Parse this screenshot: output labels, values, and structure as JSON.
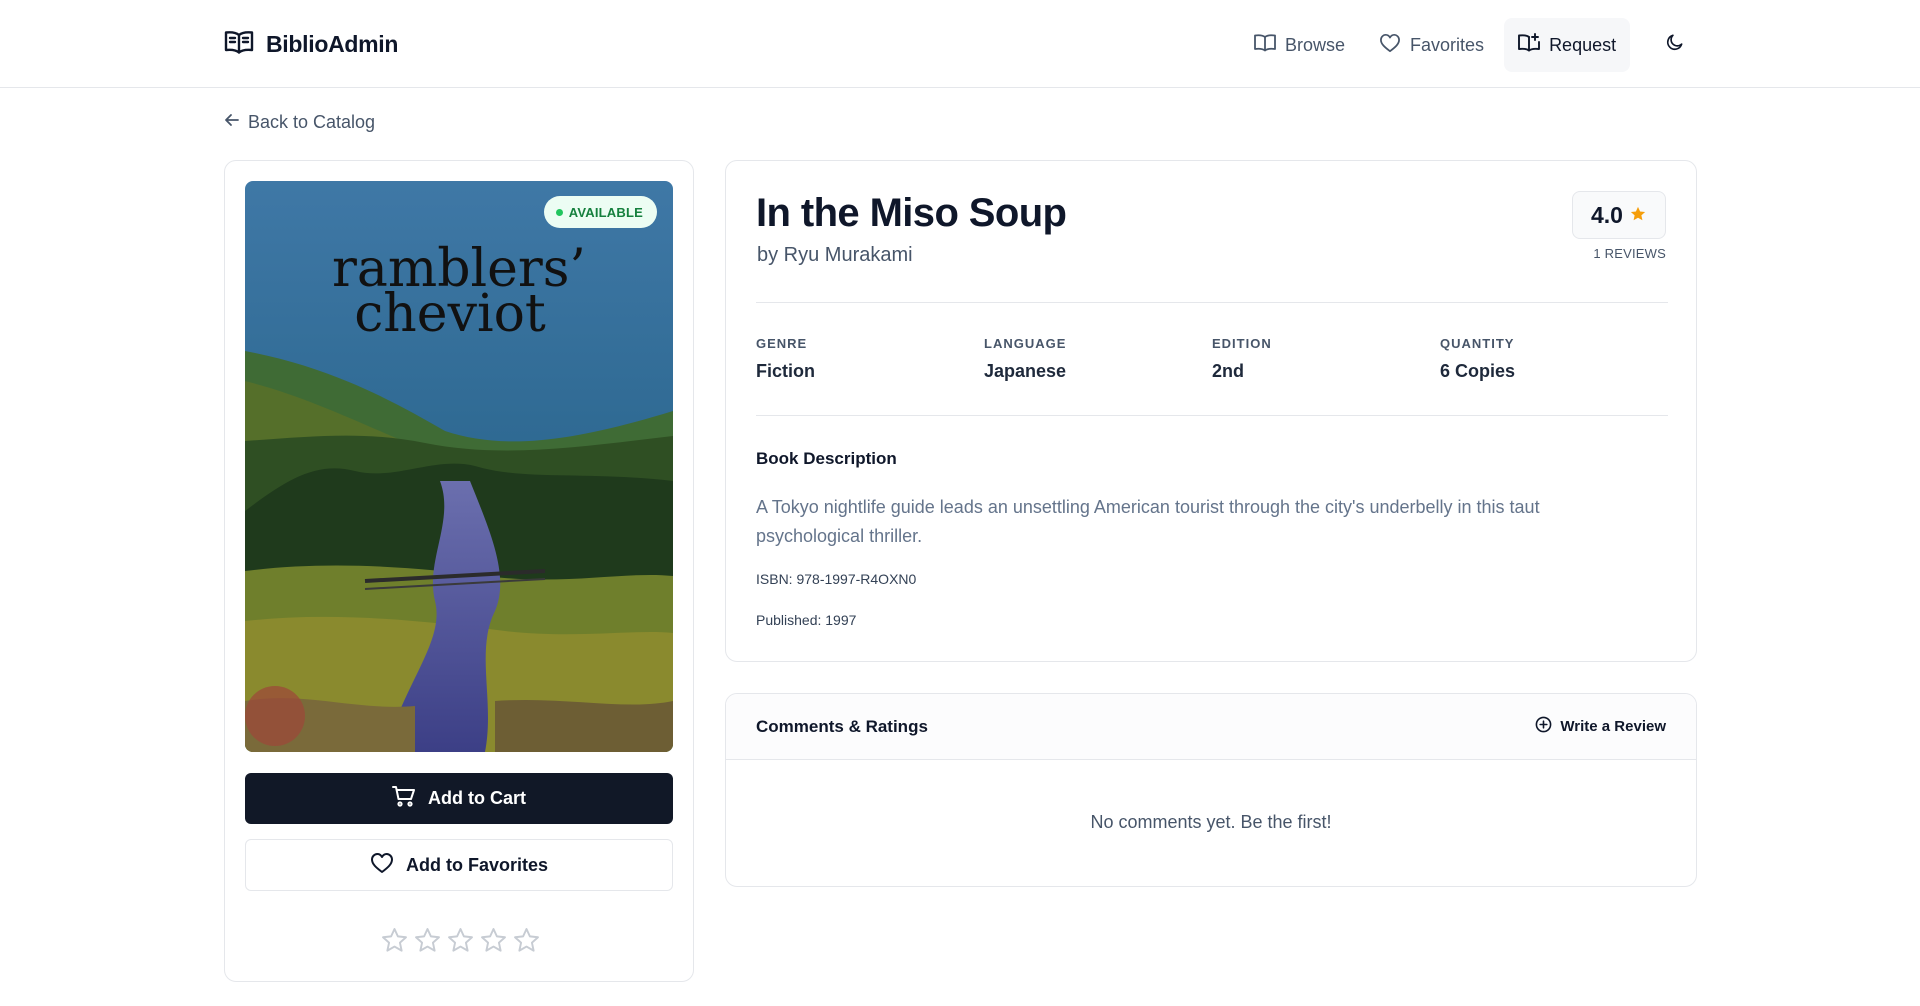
{
  "app": {
    "name": "BiblioAdmin"
  },
  "nav": {
    "items": [
      {
        "label": "Browse",
        "icon": "book-open-icon"
      },
      {
        "label": "Favorites",
        "icon": "heart-icon"
      },
      {
        "label": "Request",
        "icon": "book-plus-icon",
        "active": true
      }
    ],
    "theme_icon": "moon-icon"
  },
  "back_link": "Back to Catalog",
  "book": {
    "status": "AVAILABLE",
    "title": "In the Miso Soup",
    "author": "by Ryu Murakami",
    "rating": "4.0",
    "reviews": "1 REVIEWS",
    "meta": [
      {
        "label": "GENRE",
        "value": "Fiction"
      },
      {
        "label": "LANGUAGE",
        "value": "Japanese"
      },
      {
        "label": "EDITION",
        "value": "2nd"
      },
      {
        "label": "QUANTITY",
        "value": "6 Copies"
      }
    ],
    "description_heading": "Book Description",
    "description": "A Tokyo nightlife guide leads an unsettling American tourist through the city's underbelly in this taut psychological thriller.",
    "isbn": "ISBN: 978-1997-R4OXN0",
    "published": "Published: 1997",
    "cover_text": [
      "ramblers’",
      "cheviot"
    ]
  },
  "actions": {
    "add_to_cart": "Add to Cart",
    "add_to_favorites": "Add to Favorites",
    "user_rating": 0
  },
  "comments": {
    "title": "Comments & Ratings",
    "write_review": "Write a Review",
    "empty": "No comments yet. Be the first!"
  },
  "colors": {
    "primary": "#111827",
    "star": "#f59e0b",
    "available": "#15803d"
  }
}
